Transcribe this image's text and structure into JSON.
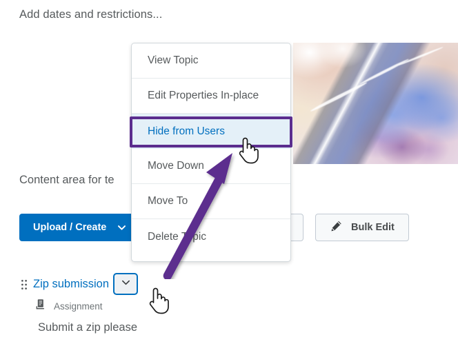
{
  "page": {
    "heading": "Add dates and restrictions...",
    "content_area_text": "Content area for te",
    "topic_description": "Submit a zip please"
  },
  "toolbar": {
    "upload_create_label": "Upload / Create",
    "upload_create_chevron": "chevron-down-icon",
    "upload_create_color": "#006fbf",
    "bulk_edit_label": "Bulk Edit",
    "bulk_edit_icon": "pencil-icon",
    "hidden_button_label": ""
  },
  "context_menu": {
    "items": [
      {
        "label": "View Topic",
        "highlighted": false
      },
      {
        "label": "Edit Properties In-place",
        "highlighted": false
      },
      {
        "label": "Hide from Users",
        "highlighted": true
      },
      {
        "label": "Move Down",
        "highlighted": false
      },
      {
        "label": "Move To",
        "highlighted": false
      },
      {
        "label": "Delete Topic",
        "highlighted": false
      }
    ],
    "highlight_bg": "#e4f0f8",
    "highlight_text": "#006fbf"
  },
  "annotation": {
    "color": "#5b2d8e",
    "shape": "arrow-and-box",
    "target": "Hide from Users"
  },
  "topic": {
    "title": "Zip submission",
    "type_label": "Assignment",
    "type_icon": "assignment-icon",
    "drag_handle_icon": "drag-handle-icon",
    "menu_chevron_icon": "chevron-down-icon",
    "link_color": "#006fbf"
  },
  "cursors": [
    {
      "name": "pointer-hand-on-menu-item"
    },
    {
      "name": "pointer-hand-on-chevron-button"
    }
  ]
}
